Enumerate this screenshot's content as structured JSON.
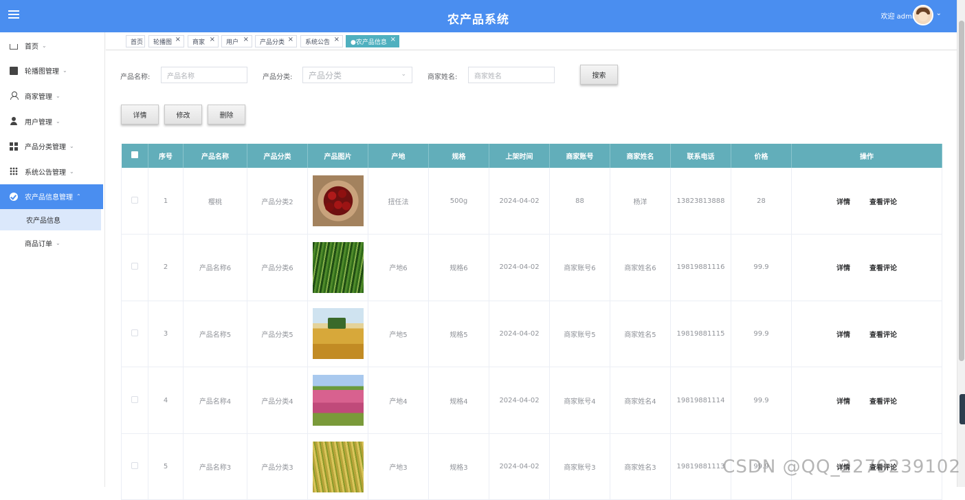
{
  "header": {
    "title": "农产品系统",
    "welcome": "欢迎 admin"
  },
  "sidebar": {
    "items": [
      {
        "label": "首页",
        "icon": "home-icon"
      },
      {
        "label": "轮播图管理",
        "icon": "image-icon"
      },
      {
        "label": "商家管理",
        "icon": "user-outline-icon"
      },
      {
        "label": "用户管理",
        "icon": "user-solid-icon"
      },
      {
        "label": "产品分类管理",
        "icon": "grid-icon"
      },
      {
        "label": "系统公告管理",
        "icon": "dots-grid-icon"
      },
      {
        "label": "农产品信息管理",
        "icon": "check-circle-icon",
        "active": true
      }
    ],
    "subitem_active": "农产品信息",
    "subitem_after": "商品订单"
  },
  "tabs": [
    {
      "label": "首页"
    },
    {
      "label": "轮播图"
    },
    {
      "label": "商家"
    },
    {
      "label": "用户"
    },
    {
      "label": "产品分类"
    },
    {
      "label": "系统公告"
    },
    {
      "label": "●农产品信息",
      "active": true
    }
  ],
  "search": {
    "name_label": "产品名称:",
    "name_placeholder": "产品名称",
    "category_label": "产品分类:",
    "category_placeholder": "产品分类",
    "merchant_label": "商家姓名:",
    "merchant_placeholder": "商家姓名",
    "search_button": "搜索"
  },
  "actions": {
    "detail": "详情",
    "edit": "修改",
    "delete": "删除"
  },
  "table": {
    "headers": [
      "序号",
      "产品名称",
      "产品分类",
      "产品图片",
      "产地",
      "规格",
      "上架时间",
      "商家账号",
      "商家姓名",
      "联系电话",
      "价格",
      "操作"
    ],
    "op_detail": "详情",
    "op_comments": "查看评论",
    "rows": [
      {
        "no": "1",
        "name": "樱桃",
        "category": "产品分类2",
        "origin": "扭任法",
        "spec": "500g",
        "date": "2024-04-02",
        "account": "88",
        "merchant": "杨洋",
        "phone": "13823813888",
        "price": "28"
      },
      {
        "no": "2",
        "name": "产品名称6",
        "category": "产品分类6",
        "origin": "产地6",
        "spec": "规格6",
        "date": "2024-04-02",
        "account": "商家账号6",
        "merchant": "商家姓名6",
        "phone": "19819881116",
        "price": "99.9"
      },
      {
        "no": "3",
        "name": "产品名称5",
        "category": "产品分类5",
        "origin": "产地5",
        "spec": "规格5",
        "date": "2024-04-02",
        "account": "商家账号5",
        "merchant": "商家姓名5",
        "phone": "19819881115",
        "price": "99.9"
      },
      {
        "no": "4",
        "name": "产品名称4",
        "category": "产品分类4",
        "origin": "产地4",
        "spec": "规格4",
        "date": "2024-04-02",
        "account": "商家账号4",
        "merchant": "商家姓名4",
        "phone": "19819881114",
        "price": "99.9"
      },
      {
        "no": "5",
        "name": "产品名称3",
        "category": "产品分类3",
        "origin": "产地3",
        "spec": "规格3",
        "date": "2024-04-02",
        "account": "商家账号3",
        "merchant": "商家姓名3",
        "phone": "19819881113",
        "price": "99.9"
      }
    ]
  },
  "watermark": "CSDN @QQ_2279239102",
  "colors": {
    "header": "#4a8ef0",
    "table_header": "#62aeba",
    "active_tab": "#4fb0bf"
  }
}
